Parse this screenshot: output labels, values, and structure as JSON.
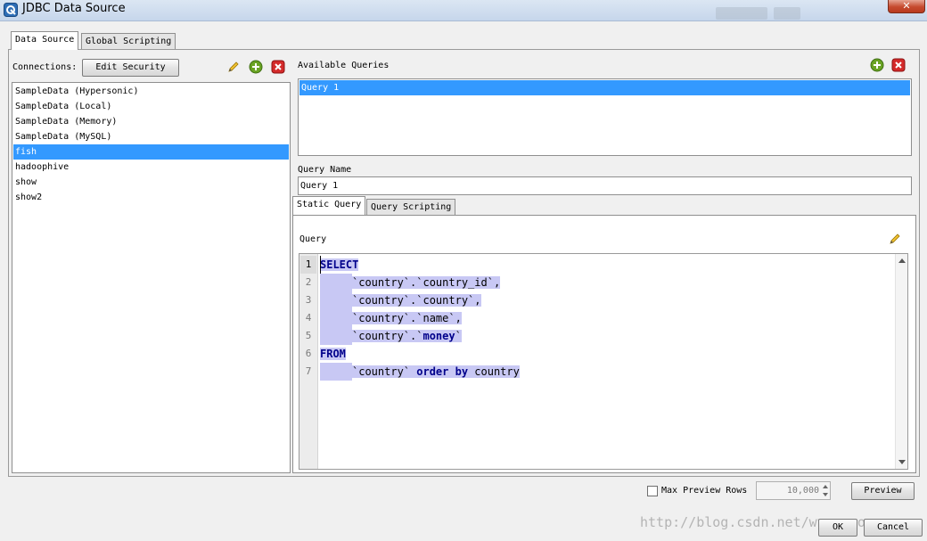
{
  "window": {
    "title": "JDBC Data Source",
    "close_glyph": "✕"
  },
  "tabs": {
    "data_source": "Data Source",
    "global_scripting": "Global Scripting"
  },
  "connections": {
    "label": "Connections:",
    "edit_security": "Edit Security",
    "items": [
      {
        "label": "SampleData (Hypersonic)",
        "selected": false
      },
      {
        "label": "SampleData (Local)",
        "selected": false
      },
      {
        "label": "SampleData (Memory)",
        "selected": false
      },
      {
        "label": "SampleData (MySQL)",
        "selected": false
      },
      {
        "label": "fish",
        "selected": true
      },
      {
        "label": "hadoophive",
        "selected": false
      },
      {
        "label": "show",
        "selected": false
      },
      {
        "label": "show2",
        "selected": false
      }
    ]
  },
  "queries": {
    "label": "Available Queries",
    "items": [
      {
        "label": "Query 1",
        "selected": true
      }
    ]
  },
  "query_name": {
    "label": "Query Name",
    "value": "Query 1"
  },
  "query_tabs": {
    "static": "Static Query",
    "scripting": "Query Scripting"
  },
  "editor": {
    "label": "Query",
    "lines": [
      {
        "no": "1",
        "indent": 0,
        "tokens": [
          {
            "t": "SELECT",
            "kw": true
          }
        ]
      },
      {
        "no": "2",
        "indent": 1,
        "tokens": [
          {
            "t": "`country`.`country_id`,",
            "kw": false
          }
        ]
      },
      {
        "no": "3",
        "indent": 1,
        "tokens": [
          {
            "t": "`country`.`country`,",
            "kw": false
          }
        ]
      },
      {
        "no": "4",
        "indent": 1,
        "tokens": [
          {
            "t": "`country`.`name`,",
            "kw": false
          }
        ]
      },
      {
        "no": "5",
        "indent": 1,
        "tokens": [
          {
            "t": "`country`.`",
            "kw": false
          },
          {
            "t": "money",
            "kw": true
          },
          {
            "t": "`",
            "kw": false
          }
        ]
      },
      {
        "no": "6",
        "indent": 0,
        "tokens": [
          {
            "t": "FROM",
            "kw": true
          }
        ]
      },
      {
        "no": "7",
        "indent": 1,
        "tokens": [
          {
            "t": "`country` ",
            "kw": false
          },
          {
            "t": "order by",
            "kw": true
          },
          {
            "t": " country",
            "kw": false
          }
        ]
      }
    ]
  },
  "bottom": {
    "max_preview_label": "Max Preview Rows",
    "max_preview_checked": false,
    "max_rows_value": "10,000",
    "preview": "Preview",
    "ok": "OK",
    "cancel": "Cancel"
  },
  "watermark": "http://blog.csdn.net/wyconyong",
  "colors": {
    "selection": "#3399ff",
    "code_highlight": "#c8c8f4",
    "keyword": "#00008b",
    "add_icon": "#6aa323",
    "remove_icon": "#d42a2a"
  },
  "icons": [
    "app-icon",
    "edit-pencil-icon",
    "add-icon",
    "remove-icon",
    "close-icon",
    "scroll-up-arrow-icon",
    "scroll-down-arrow-icon",
    "spinner-up-icon",
    "spinner-down-icon"
  ]
}
